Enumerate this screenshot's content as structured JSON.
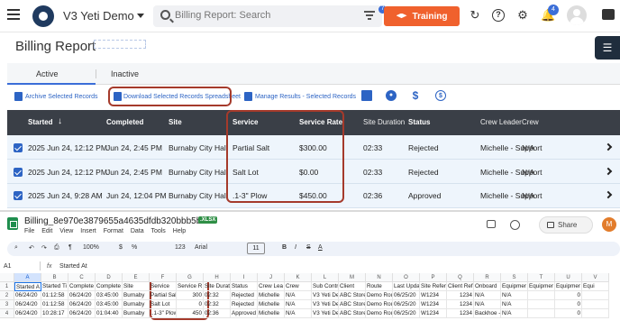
{
  "app": {
    "name": "V3 Yeti Demo",
    "search_placeholder": "Billing Report: Search",
    "training_label": "Training",
    "notif_small_badge": "7",
    "bell_badge": "4"
  },
  "page": {
    "title": "Billing Report"
  },
  "tabs": [
    {
      "label": "Active"
    },
    {
      "label": "Inactive"
    }
  ],
  "toolbar": {
    "archive": "Archive Selected Records",
    "download": "Download Selected Records Spreadsheet",
    "manage": "Manage Results - Selected Records",
    "dollar": "$"
  },
  "table": {
    "headers": [
      "Started",
      "Completed",
      "Site",
      "Service",
      "Service Rate",
      "Site Duration",
      "Status",
      "Crew Leader",
      "Crew"
    ],
    "sort_arrow": "↓",
    "rows": [
      {
        "started": "2025 Jun 24, 12:12 PM",
        "completed": "Jun 24, 2:45 PM",
        "site": "Burnaby City Hall",
        "service": "Partial Salt",
        "rate": "$300.00",
        "duration": "02:33",
        "status": "Rejected",
        "leader": "Michelle - Support",
        "crew": "N/A"
      },
      {
        "started": "2025 Jun 24, 12:12 PM",
        "completed": "Jun 24, 2:45 PM",
        "site": "Burnaby City Hall",
        "service": "Salt Lot",
        "rate": "$0.00",
        "duration": "02:33",
        "status": "Rejected",
        "leader": "Michelle - Support",
        "crew": "N/A"
      },
      {
        "started": "2025 Jun 24, 9:28 AM",
        "completed": "Jun 24, 12:04 PM",
        "site": "Burnaby City Hall",
        "service": ".1-3\" Plow",
        "rate": "$450.00",
        "duration": "02:36",
        "status": "Approved",
        "leader": "Michelle - Support",
        "crew": "N/A"
      }
    ]
  },
  "sheet": {
    "file_name": "Billing_8e970e3879655a4635dfdb320bbb5b07",
    "ext": ".XLSX",
    "menu": [
      "File",
      "Edit",
      "View",
      "Insert",
      "Format",
      "Data",
      "Tools",
      "Help"
    ],
    "share_label": "Share",
    "avatar": "M",
    "zoom": "100%",
    "font": "Arial",
    "font_size": "11",
    "toolbar_glyphs": {
      "currency": "$",
      "percent": "%",
      "num_format": "123",
      "bold": "B",
      "italic": "I",
      "strike": "S",
      "text_color": "A"
    },
    "cell_ref": "A1",
    "formula": "Started At",
    "col_letters": [
      "A",
      "B",
      "C",
      "D",
      "E",
      "F",
      "G",
      "H",
      "I",
      "J",
      "K",
      "L",
      "M",
      "N",
      "O",
      "P",
      "Q",
      "R",
      "S",
      "T",
      "U",
      "V"
    ],
    "row_numbers": [
      "1",
      "2",
      "3",
      "4"
    ],
    "rows": [
      [
        "Started A",
        "Started Ti",
        "Complete",
        "Complete",
        "Site",
        "Service",
        "Service R",
        "Site Durat",
        "Status",
        "Crew Lea",
        "Crew",
        "Sub Contr",
        "Client",
        "Route",
        "Last Upda",
        "Site Refer",
        "Client Ref",
        "Onboard",
        "Equipmer",
        "Equipmer",
        "Equipmer",
        "Equi"
      ],
      [
        "06/24/20",
        "01:12:58",
        "06/24/20",
        "03:45:00",
        "Burnaby",
        "Partial Sal",
        "300",
        "02:32",
        "Rejected",
        "Michelle",
        "N/A",
        "V3 Yeti De",
        "ABC Store",
        "Demo Rou",
        "06/25/20",
        "W1234",
        "1234",
        "N/A",
        "N/A",
        "",
        "0",
        ""
      ],
      [
        "06/24/20",
        "01:12:58",
        "06/24/20",
        "03:45:00",
        "Burnaby",
        "Salt Lot",
        "0",
        "02:32",
        "Rejected",
        "Michelle",
        "N/A",
        "V3 Yeti De",
        "ABC Store",
        "Demo Rou",
        "06/25/20",
        "W1234",
        "1234",
        "N/A",
        "N/A",
        "",
        "0",
        ""
      ],
      [
        "06/24/20",
        "10:28:17",
        "06/24/20",
        "01:04:40",
        "Burnaby",
        "..1-3\" Plow",
        "450",
        "02:36",
        "Approved",
        "Michelle",
        "N/A",
        "V3 Yeti De",
        "ABC Store",
        "Demo Rou",
        "06/25/20",
        "W1234",
        "1234",
        "Backhoe - Kelly; Ch",
        "N/A",
        "",
        "0",
        ""
      ]
    ]
  }
}
